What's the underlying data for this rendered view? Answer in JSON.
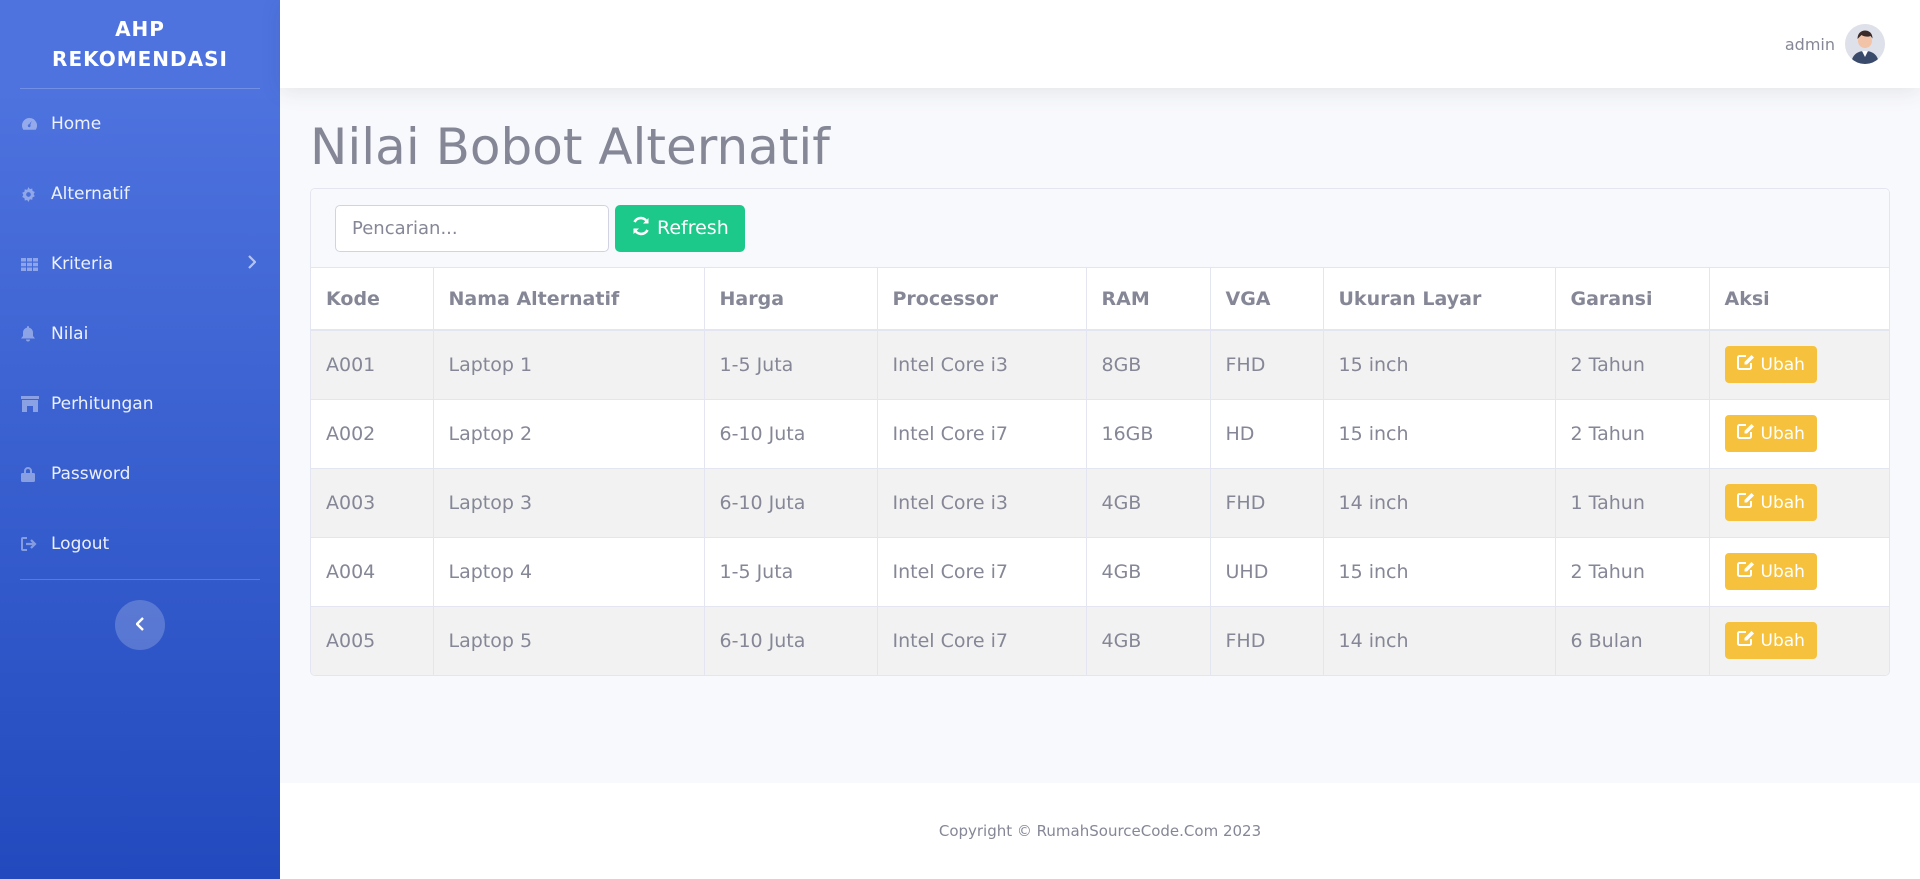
{
  "brand": {
    "line1": "AHP",
    "line2": "REKOMENDASI"
  },
  "sidebar": {
    "items": [
      {
        "label": "Home",
        "icon": "tachometer-icon"
      },
      {
        "label": "Alternatif",
        "icon": "cog-icon"
      },
      {
        "label": "Kriteria",
        "icon": "table-icon",
        "has_submenu": true
      },
      {
        "label": "Nilai",
        "icon": "bell-icon"
      },
      {
        "label": "Perhitungan",
        "icon": "building-icon"
      },
      {
        "label": "Password",
        "icon": "lock-icon"
      },
      {
        "label": "Logout",
        "icon": "sign-out-icon"
      }
    ],
    "toggle_icon": "chevron-left-icon"
  },
  "topbar": {
    "user_name": "admin",
    "avatar_icon": "user-avatar"
  },
  "page": {
    "title": "Nilai Bobot Alternatif"
  },
  "toolbar": {
    "search_placeholder": "Pencarian...",
    "refresh_label": "Refresh",
    "refresh_icon": "refresh-icon"
  },
  "table": {
    "headers": [
      "Kode",
      "Nama Alternatif",
      "Harga",
      "Processor",
      "RAM",
      "VGA",
      "Ukuran Layar",
      "Garansi",
      "Aksi"
    ],
    "rows": [
      [
        "A001",
        "Laptop 1",
        "1-5 Juta",
        "Intel Core i3",
        "8GB",
        "FHD",
        "15 inch",
        "2 Tahun"
      ],
      [
        "A002",
        "Laptop 2",
        "6-10 Juta",
        "Intel Core i7",
        "16GB",
        "HD",
        "15 inch",
        "2 Tahun"
      ],
      [
        "A003",
        "Laptop 3",
        "6-10 Juta",
        "Intel Core i3",
        "4GB",
        "FHD",
        "14 inch",
        "1 Tahun"
      ],
      [
        "A004",
        "Laptop 4",
        "1-5 Juta",
        "Intel Core i7",
        "4GB",
        "UHD",
        "15 inch",
        "2 Tahun"
      ],
      [
        "A005",
        "Laptop 5",
        "6-10 Juta",
        "Intel Core i7",
        "4GB",
        "FHD",
        "14 inch",
        "6 Bulan"
      ]
    ],
    "action_label": "Ubah",
    "action_icon": "edit-icon"
  },
  "footer": {
    "copyright": "Copyright © RumahSourceCode.Com 2023"
  },
  "colors": {
    "sidebar_top": "#4e73df",
    "sidebar_bottom": "#224abe",
    "success": "#1cc88a",
    "warning": "#f6c23e",
    "text": "#858796"
  }
}
